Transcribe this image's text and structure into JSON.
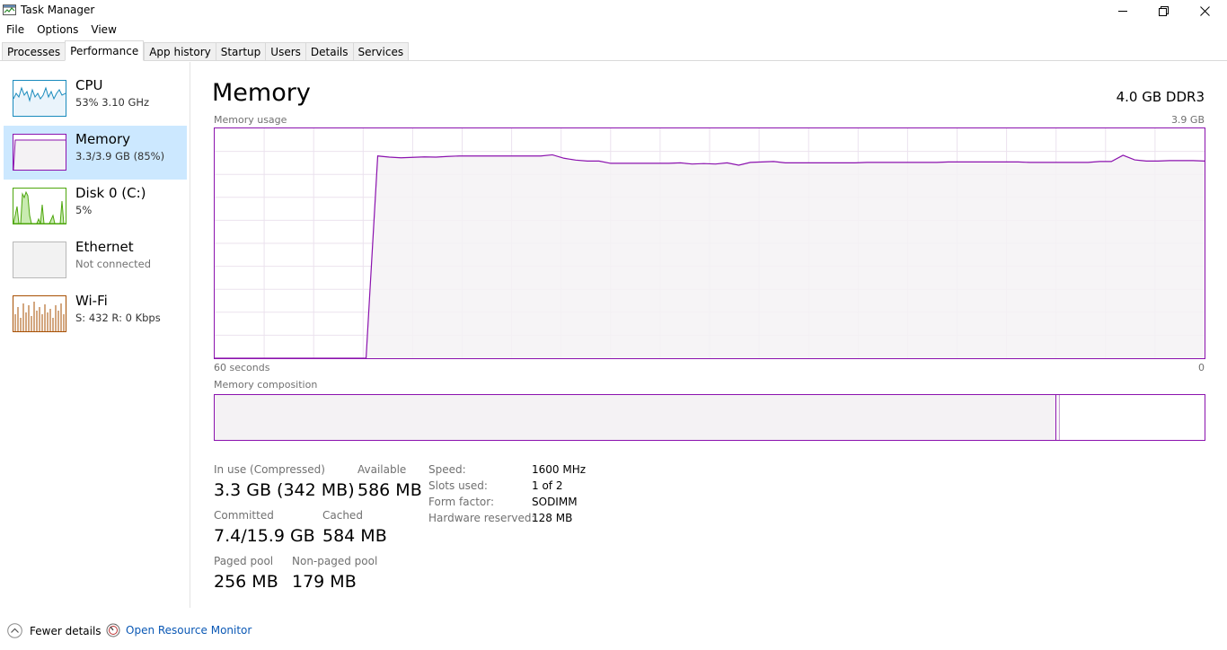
{
  "window": {
    "title": "Task Manager"
  },
  "menu": [
    "File",
    "Options",
    "View"
  ],
  "tabs": [
    {
      "label": "Processes"
    },
    {
      "label": "Performance",
      "active": true
    },
    {
      "label": "App history"
    },
    {
      "label": "Startup"
    },
    {
      "label": "Users"
    },
    {
      "label": "Details"
    },
    {
      "label": "Services"
    }
  ],
  "sidebar": {
    "items": [
      {
        "name": "CPU",
        "sub": "53%  3.10 GHz"
      },
      {
        "name": "Memory",
        "sub": "3.3/3.9 GB (85%)",
        "selected": true
      },
      {
        "name": "Disk 0 (C:)",
        "sub": "5%"
      },
      {
        "name": "Ethernet",
        "sub": "Not connected"
      },
      {
        "name": "Wi-Fi",
        "sub": "S: 432  R: 0 Kbps"
      }
    ]
  },
  "main": {
    "title": "Memory",
    "spec": "4.0 GB DDR3",
    "usage_label": "Memory usage",
    "usage_max": "3.9 GB",
    "time_left": "60 seconds",
    "time_right": "0",
    "composition_label": "Memory composition",
    "composition": {
      "in_use_pct": 85
    },
    "stats": {
      "in_use": {
        "label": "In use (Compressed)",
        "value": "3.3 GB (342 MB)"
      },
      "available": {
        "label": "Available",
        "value": "586 MB"
      },
      "committed": {
        "label": "Committed",
        "value": "7.4/15.9 GB"
      },
      "cached": {
        "label": "Cached",
        "value": "584 MB"
      },
      "paged_pool": {
        "label": "Paged pool",
        "value": "256 MB"
      },
      "nonpaged_pool": {
        "label": "Non-paged pool",
        "value": "179 MB"
      }
    },
    "details": [
      {
        "key": "Speed:",
        "value": "1600 MHz"
      },
      {
        "key": "Slots used:",
        "value": "1 of 2"
      },
      {
        "key": "Form factor:",
        "value": "SODIMM"
      },
      {
        "key": "Hardware reserved:",
        "value": "128 MB"
      }
    ],
    "usage_series_pct": [
      0,
      0,
      0,
      0,
      0,
      0,
      0,
      0,
      0,
      0,
      0,
      0,
      0,
      0,
      88,
      87.5,
      87.2,
      87.4,
      87.6,
      87.5,
      87.8,
      88,
      88,
      88,
      88,
      88,
      88,
      88,
      88,
      88.5,
      87,
      86.2,
      85.8,
      85.8,
      84.8,
      84.8,
      84.8,
      84.8,
      84.8,
      84.8,
      85,
      84.5,
      84.7,
      84.5,
      85,
      84,
      85.2,
      85.4,
      85.6,
      85,
      85,
      85,
      85,
      85,
      85,
      85,
      85.2,
      85.2,
      85.2,
      85.2,
      85.2,
      85.2,
      85.2,
      85.4,
      85.4,
      85.4,
      85.4,
      85.4,
      85.4,
      85.4,
      85.2,
      85.2,
      85.2,
      85.2,
      85.2,
      85.2,
      85.6,
      85.6,
      88.3,
      86.3,
      85.8,
      85.8,
      86,
      86,
      86,
      85.8
    ]
  },
  "footer": {
    "fewer_details": "Fewer details",
    "resource_monitor": "Open Resource Monitor"
  },
  "colors": {
    "memory_accent": "#8b12ae",
    "memory_fill": "#f4f2f4",
    "selected_bg": "#cce8ff",
    "link": "#0a58b5"
  }
}
